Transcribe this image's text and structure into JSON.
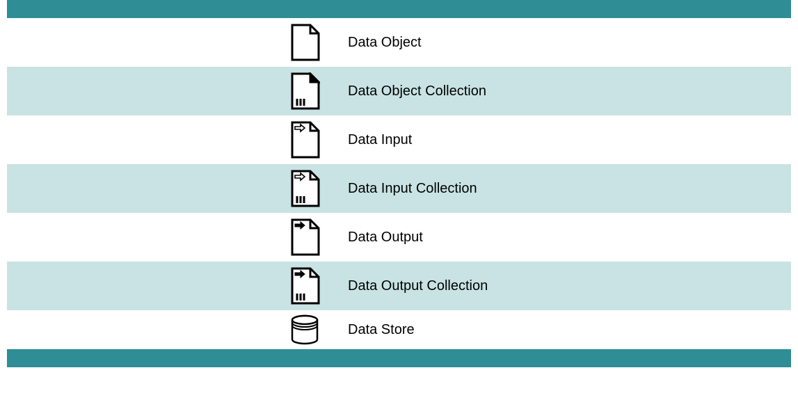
{
  "rows": [
    {
      "label": "Data Object"
    },
    {
      "label": "Data Object Collection"
    },
    {
      "label": "Data Input"
    },
    {
      "label": "Data Input Collection"
    },
    {
      "label": "Data Output"
    },
    {
      "label": "Data Output Collection"
    },
    {
      "label": "Data Store"
    }
  ]
}
